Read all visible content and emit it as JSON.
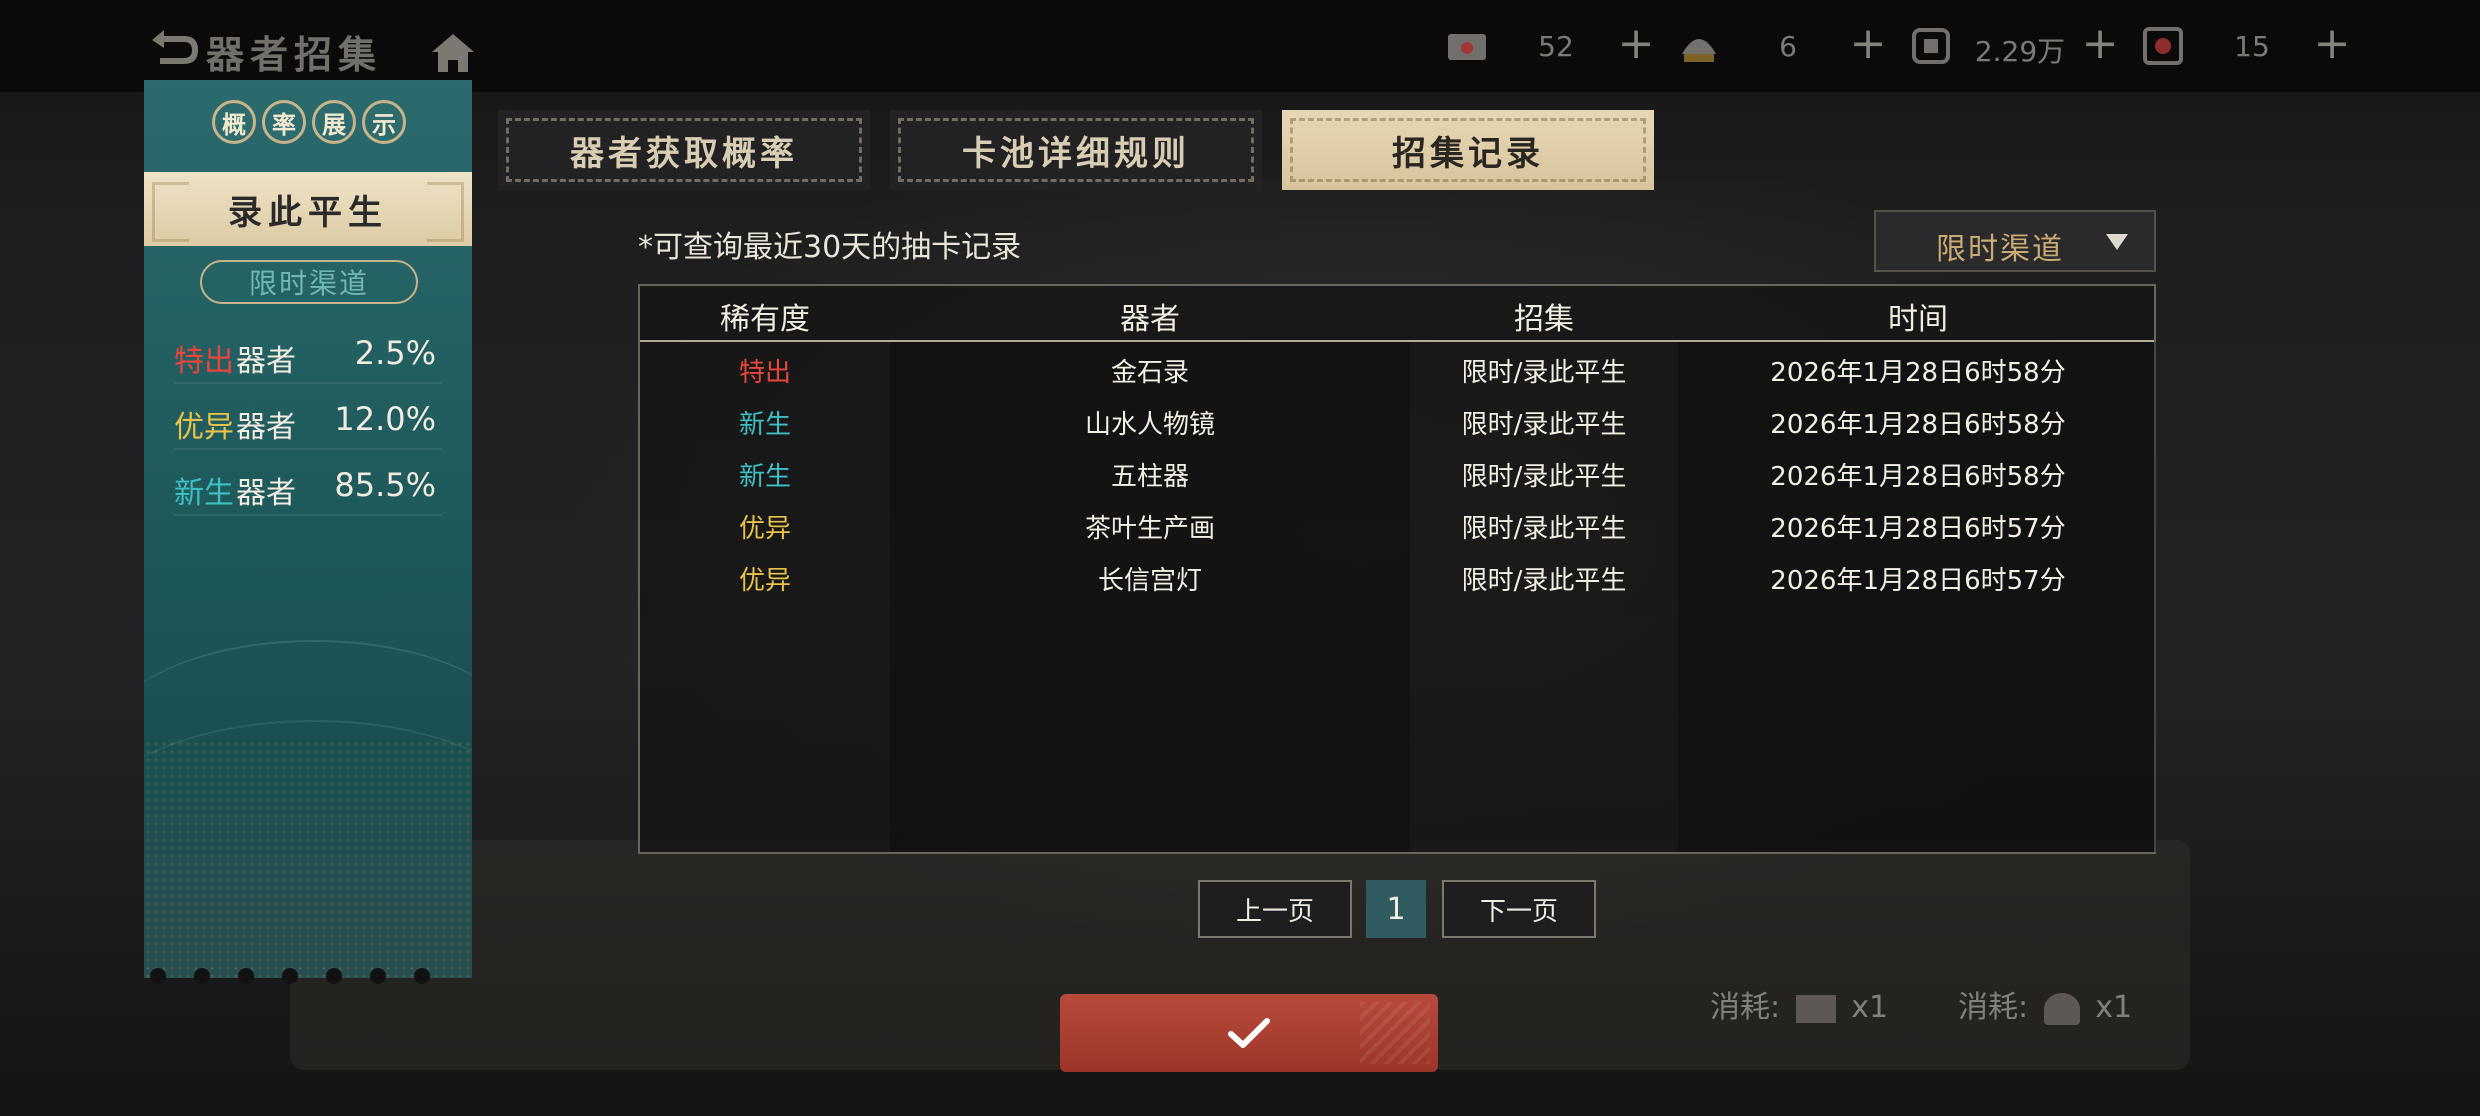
{
  "header": {
    "title": "器者招集",
    "resources": [
      {
        "icon": "envelope-ticket-icon",
        "value": "52"
      },
      {
        "icon": "lantern-ticket-icon",
        "value": "6"
      },
      {
        "icon": "currency-coin-icon",
        "value": "2.29万"
      },
      {
        "icon": "gem-crystal-icon",
        "value": "15"
      }
    ],
    "plus_label": "+"
  },
  "left_panel": {
    "heading_chars": [
      "概",
      "率",
      "展",
      "示"
    ],
    "pool_name": "录此平生",
    "channel": "限时渠道",
    "rates": [
      {
        "rarity": "特出",
        "kind": "器者",
        "percent": "2.5%",
        "color": "#e8453c"
      },
      {
        "rarity": "优异",
        "kind": "器者",
        "percent": "12.0%",
        "color": "#e8c24a"
      },
      {
        "rarity": "新生",
        "kind": "器者",
        "percent": "85.5%",
        "color": "#3fbfc3"
      }
    ]
  },
  "tabs": [
    {
      "label": "器者获取概率",
      "active": false
    },
    {
      "label": "卡池详细规则",
      "active": false
    },
    {
      "label": "招集记录",
      "active": true
    }
  ],
  "record": {
    "note": "*可查询最近30天的抽卡记录",
    "filter": "限时渠道",
    "columns": [
      "稀有度",
      "器者",
      "招集",
      "时间"
    ],
    "rows": [
      {
        "rarity": "特出",
        "rarity_color": "#e8453c",
        "name": "金石录",
        "source": "限时/录此平生",
        "time": "2026年1月28日6时58分"
      },
      {
        "rarity": "新生",
        "rarity_color": "#3fbfc3",
        "name": "山水人物镜",
        "source": "限时/录此平生",
        "time": "2026年1月28日6时58分"
      },
      {
        "rarity": "新生",
        "rarity_color": "#3fbfc3",
        "name": "五柱器",
        "source": "限时/录此平生",
        "time": "2026年1月28日6时58分"
      },
      {
        "rarity": "优异",
        "rarity_color": "#e8c24a",
        "name": "茶叶生产画",
        "source": "限时/录此平生",
        "time": "2026年1月28日6时57分"
      },
      {
        "rarity": "优异",
        "rarity_color": "#e8c24a",
        "name": "长信宫灯",
        "source": "限时/录此平生",
        "time": "2026年1月28日6时57分"
      }
    ]
  },
  "pagination": {
    "prev": "上一页",
    "page": "1",
    "next": "下一页"
  },
  "background": {
    "cost_label_1": "消耗:",
    "cost_qty_1": "x1",
    "cost_label_2": "消耗:",
    "cost_qty_2": "x1"
  }
}
